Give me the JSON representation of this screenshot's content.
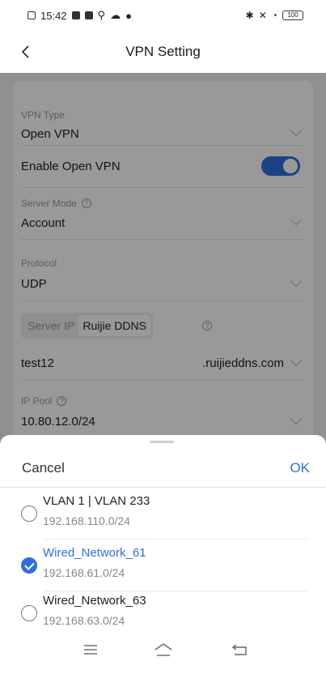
{
  "status_bar": {
    "time": "15:42",
    "battery": "100"
  },
  "header": {
    "title": "VPN Setting"
  },
  "form": {
    "vpn_type_label": "VPN Type",
    "vpn_type_value": "Open VPN",
    "enable_label": "Enable Open VPN",
    "enable_on": true,
    "server_mode_label": "Server Mode",
    "server_mode_value": "Account",
    "protocol_label": "Protocol",
    "protocol_value": "UDP",
    "seg_server_ip": "Server IP",
    "seg_ruijie_ddns": "Ruijie DDNS",
    "ddns_value": "test12",
    "ddns_suffix": ".ruijieddns.com",
    "ip_pool_label": "IP Pool",
    "ip_pool_value": "10.80.12.0/24"
  },
  "sheet": {
    "cancel": "Cancel",
    "ok": "OK",
    "options": [
      {
        "name": "VLAN 1 | VLAN 233",
        "subnet": "192.168.110.0/24",
        "selected": false
      },
      {
        "name": "Wired_Network_61",
        "subnet": "192.168.61.0/24",
        "selected": true
      },
      {
        "name": "Wired_Network_63",
        "subnet": "192.168.63.0/24",
        "selected": false
      }
    ]
  },
  "colors": {
    "accent": "#2f6fde"
  }
}
